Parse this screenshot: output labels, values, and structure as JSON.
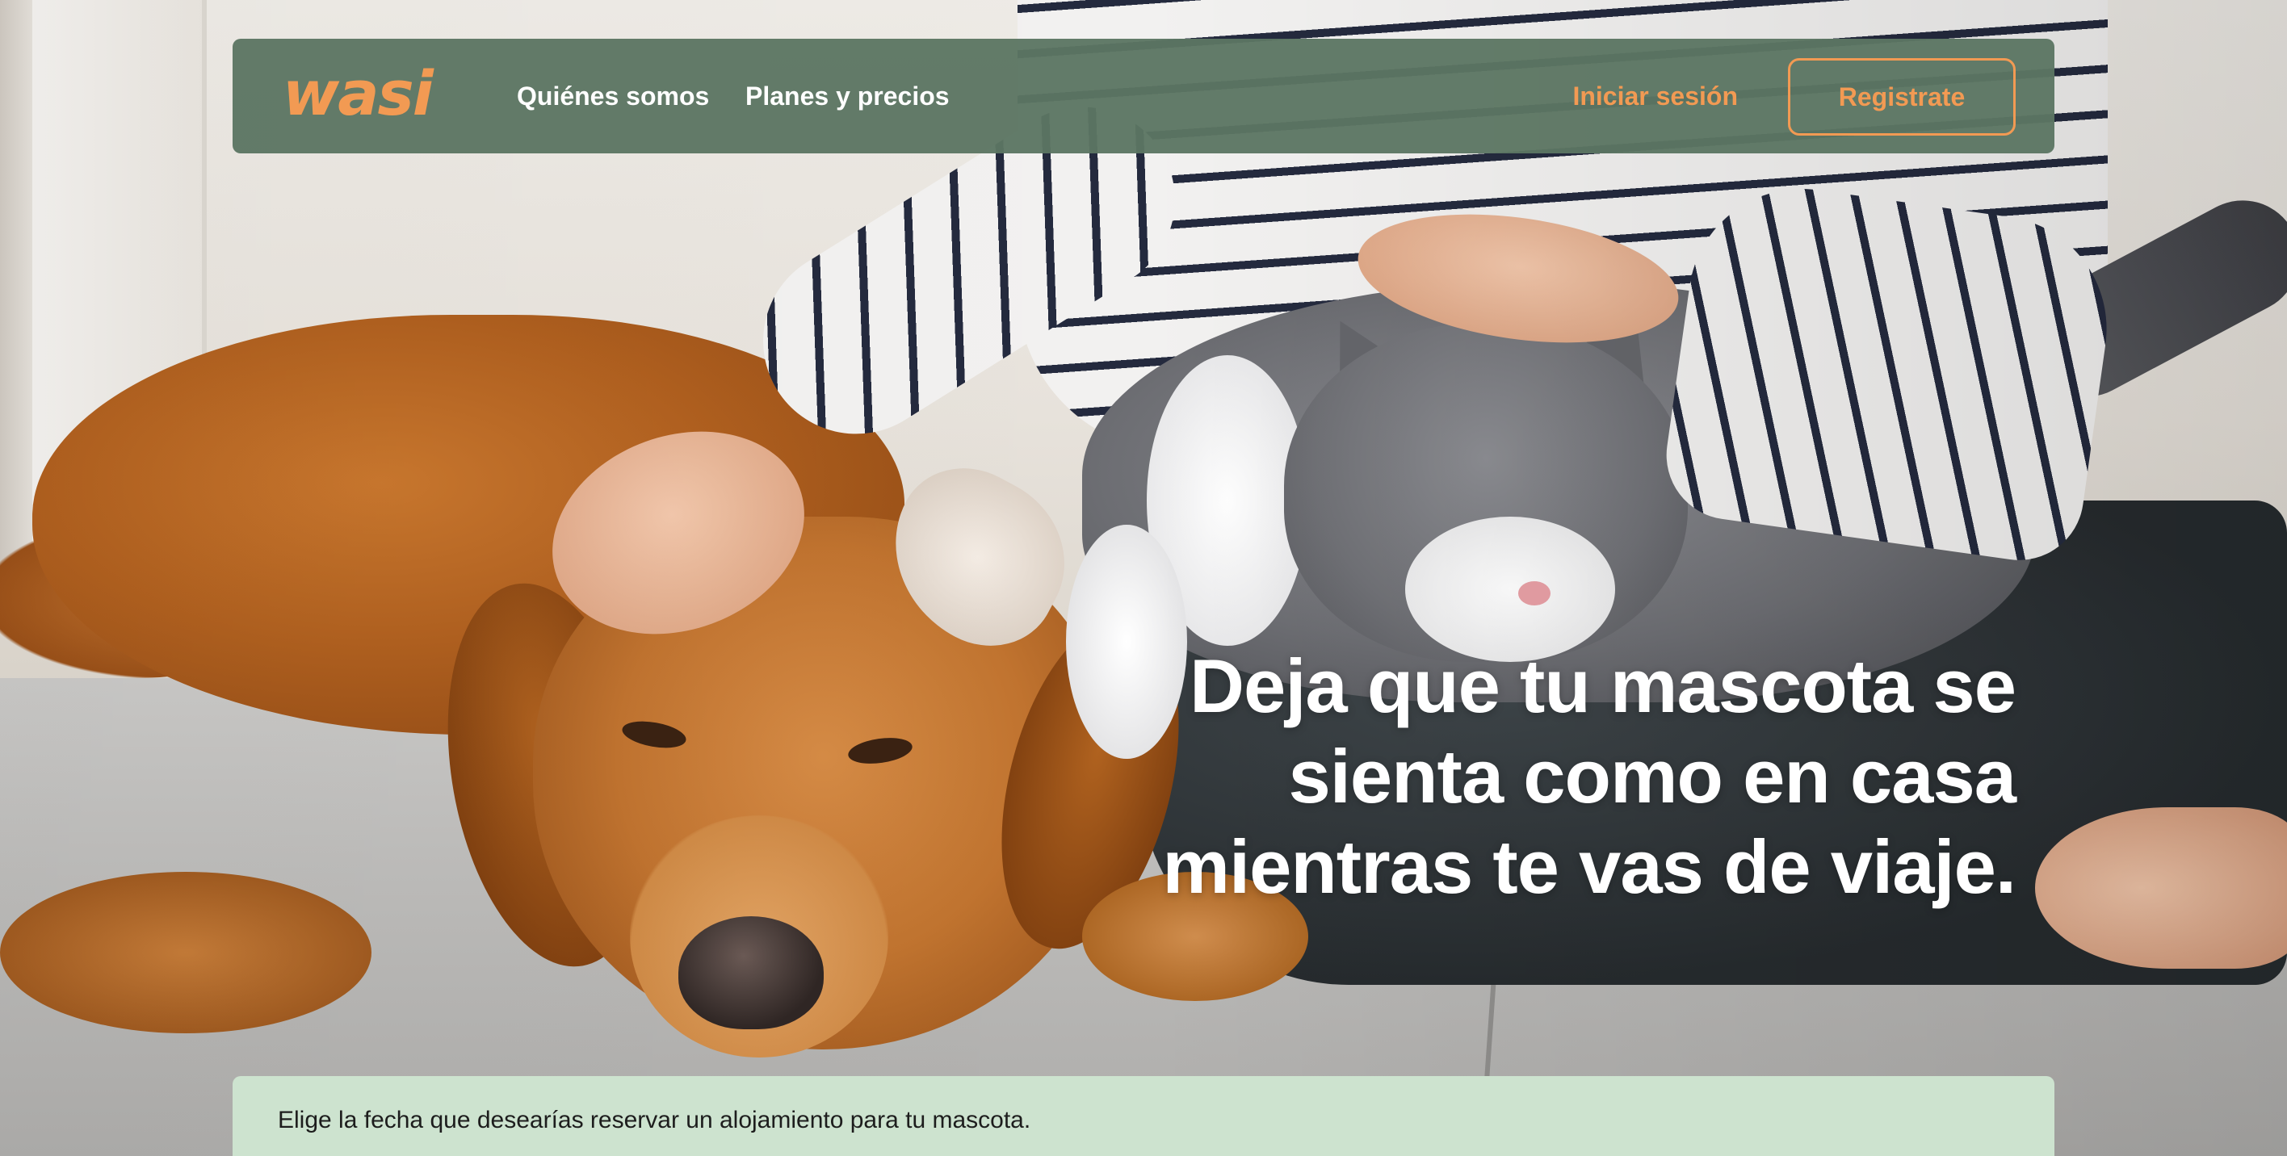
{
  "navbar": {
    "logo": "wasi",
    "links": [
      "Quiénes somos",
      "Planes y precios"
    ],
    "login": "Iniciar sesión",
    "register": "Registrate"
  },
  "hero": {
    "headline_lines": [
      "Deja que tu mascota se",
      "sienta como en casa",
      "mientras te vas de viaje."
    ]
  },
  "booking": {
    "prompt": "Elige la fecha que desearías reservar un alojamiento para tu mascota."
  },
  "colors": {
    "accent": "#f29a53",
    "navbar_bg": "#5c7663",
    "booking_bg": "#cde3cf"
  }
}
